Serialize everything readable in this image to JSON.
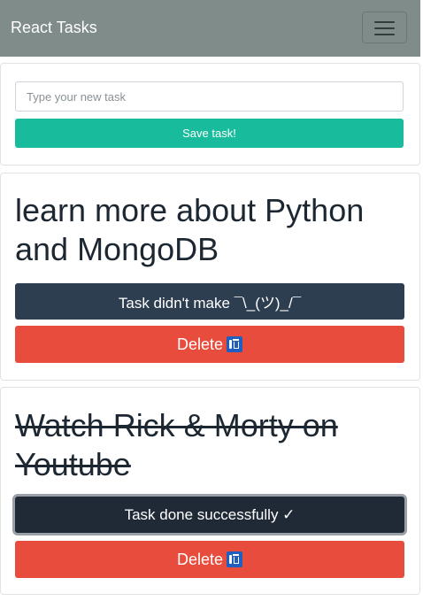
{
  "navbar": {
    "brand": "React Tasks"
  },
  "form": {
    "placeholder": "Type your new task",
    "value": "",
    "save_label": "Save task!"
  },
  "tasks": [
    {
      "title": "learn more about Python and MongoDB",
      "done": false,
      "status_label": "Task didn't make ¯\\_(ツ)_/¯",
      "delete_label": "Delete",
      "delete_icon": "wastebasket-icon"
    },
    {
      "title": "Watch Rick & Morty on Youtube",
      "done": true,
      "status_label": "Task done successfully ✓",
      "delete_label": "Delete",
      "delete_icon": "wastebasket-icon"
    }
  ],
  "colors": {
    "navbar": "#7f8c8a",
    "save": "#18bc9c",
    "pending": "#2c3e50",
    "done": "#1f2a36",
    "delete": "#e74c3c",
    "trash_icon": "#1f5fbf"
  }
}
